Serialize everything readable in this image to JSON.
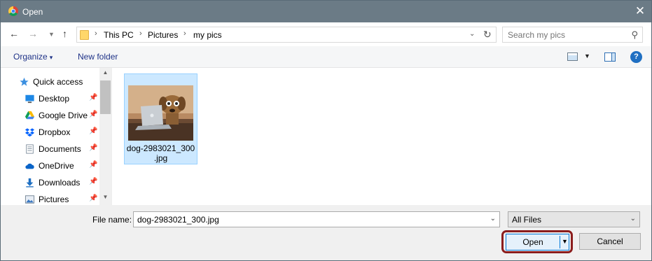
{
  "window": {
    "title": "Open",
    "close_icon": "close-icon",
    "app_icon": "chrome-icon"
  },
  "navigation": {
    "back_icon": "back-arrow-icon",
    "forward_icon": "forward-arrow-icon",
    "recent_icon": "chevron-down-icon",
    "up_icon": "up-arrow-icon"
  },
  "address": {
    "breadcrumbs": [
      "This PC",
      "Pictures",
      "my pics"
    ],
    "refresh_icon": "refresh-icon"
  },
  "search": {
    "placeholder": "Search my pics",
    "icon": "search-icon"
  },
  "toolbar": {
    "organize_label": "Organize",
    "new_folder_label": "New folder",
    "help_label": "?"
  },
  "sidebar": {
    "items": [
      {
        "label": "Quick access",
        "icon": "star-icon",
        "pinned": false
      },
      {
        "label": "Desktop",
        "icon": "desktop-icon",
        "pinned": true
      },
      {
        "label": "Google Drive",
        "icon": "google-drive-icon",
        "pinned": true
      },
      {
        "label": "Dropbox",
        "icon": "dropbox-icon",
        "pinned": true
      },
      {
        "label": "Documents",
        "icon": "documents-icon",
        "pinned": true
      },
      {
        "label": "OneDrive",
        "icon": "onedrive-icon",
        "pinned": true
      },
      {
        "label": "Downloads",
        "icon": "downloads-icon",
        "pinned": true
      },
      {
        "label": "Pictures",
        "icon": "pictures-icon",
        "pinned": true
      }
    ]
  },
  "files": [
    {
      "name_line1": "dog-2983021_300",
      "name_line2": ".jpg",
      "selected": true
    }
  ],
  "footer": {
    "file_name_label": "File name:",
    "file_name_value": "dog-2983021_300.jpg",
    "file_type_value": "All Files",
    "open_label": "Open",
    "cancel_label": "Cancel"
  },
  "colors": {
    "titlebar": "#6b7b86",
    "selection": "#cce8ff",
    "link": "#1e3287",
    "highlight_ring": "#8b1d1d",
    "primary_border": "#0078d7"
  }
}
